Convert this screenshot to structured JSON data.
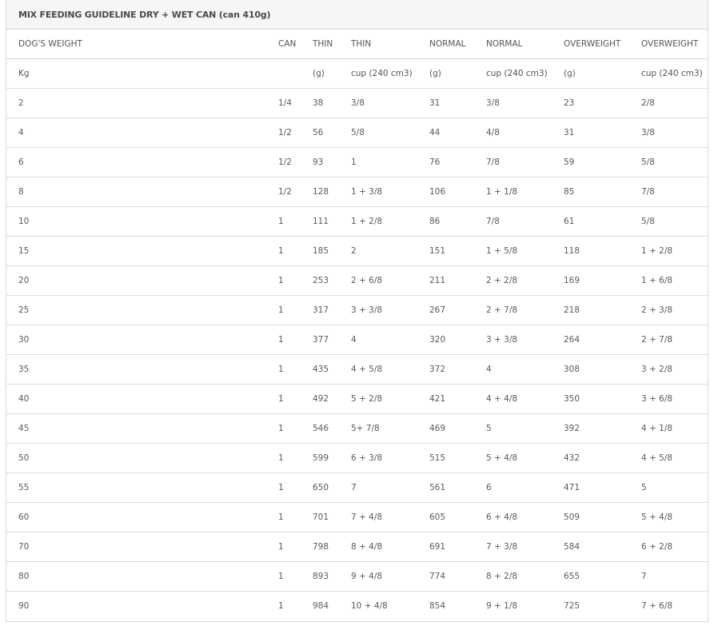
{
  "title": "MIX FEEDING GUIDELINE DRY + WET CAN (can 410g)",
  "headers": [
    "DOG'S WEIGHT",
    "CAN",
    "THIN",
    "THIN",
    "NORMAL",
    "NORMAL",
    "OVERWEIGHT",
    "OVERWEIGHT"
  ],
  "units": [
    "Kg",
    "",
    "(g)",
    "cup (240 cm3)",
    "(g)",
    "cup (240 cm3)",
    "(g)",
    "cup (240 cm3)"
  ],
  "rows": [
    [
      "2",
      "1/4",
      "38",
      "3/8",
      "31",
      "3/8",
      "23",
      "2/8"
    ],
    [
      "4",
      "1/2",
      "56",
      "5/8",
      "44",
      "4/8",
      "31",
      "3/8"
    ],
    [
      "6",
      "1/2",
      "93",
      "1",
      "76",
      "7/8",
      "59",
      "5/8"
    ],
    [
      "8",
      "1/2",
      "128",
      "1 + 3/8",
      "106",
      "1 + 1/8",
      "85",
      "7/8"
    ],
    [
      "10",
      "1",
      "111",
      "1 + 2/8",
      "86",
      "7/8",
      "61",
      "5/8"
    ],
    [
      "15",
      "1",
      "185",
      "2",
      "151",
      "1 + 5/8",
      "118",
      "1 + 2/8"
    ],
    [
      "20",
      "1",
      "253",
      "2 + 6/8",
      "211",
      "2 + 2/8",
      "169",
      "1 + 6/8"
    ],
    [
      "25",
      "1",
      "317",
      "3 + 3/8",
      "267",
      "2 + 7/8",
      "218",
      "2 + 3/8"
    ],
    [
      "30",
      "1",
      "377",
      "4",
      "320",
      "3 + 3/8",
      "264",
      "2 + 7/8"
    ],
    [
      "35",
      "1",
      "435",
      "4 + 5/8",
      "372",
      "4",
      "308",
      "3 + 2/8"
    ],
    [
      "40",
      "1",
      "492",
      "5 + 2/8",
      "421",
      "4 + 4/8",
      "350",
      "3 + 6/8"
    ],
    [
      "45",
      "1",
      "546",
      "5+ 7/8",
      "469",
      "5",
      "392",
      "4 + 1/8"
    ],
    [
      "50",
      "1",
      "599",
      "6 + 3/8",
      "515",
      "5 + 4/8",
      "432",
      "4 + 5/8"
    ],
    [
      "55",
      "1",
      "650",
      "7",
      "561",
      "6",
      "471",
      "5"
    ],
    [
      "60",
      "1",
      "701",
      "7 + 4/8",
      "605",
      "6 + 4/8",
      "509",
      "5 + 4/8"
    ],
    [
      "70",
      "1",
      "798",
      "8 + 4/8",
      "691",
      "7 + 3/8",
      "584",
      "6 + 2/8"
    ],
    [
      "80",
      "1",
      "893",
      "9 + 4/8",
      "774",
      "8 + 2/8",
      "655",
      "7"
    ],
    [
      "90",
      "1",
      "984",
      "10 + 4/8",
      "854",
      "9 + 1/8",
      "725",
      "7 + 6/8"
    ]
  ]
}
